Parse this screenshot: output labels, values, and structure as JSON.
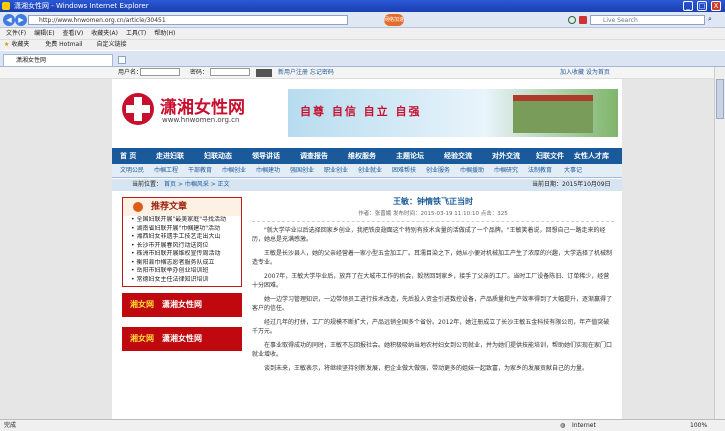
{
  "window": {
    "title": "潇湘女性网 - Windows Internet Explorer",
    "minimize": "_",
    "maximize": "□",
    "close": "X"
  },
  "address": {
    "url": "http://www.hnwomen.org.cn/article/30451",
    "search_placeholder": "Live Search",
    "popup_label": "网络加速"
  },
  "menu": [
    "文件(F)",
    "编辑(E)",
    "查看(V)",
    "收藏夹(A)",
    "工具(T)",
    "帮助(H)"
  ],
  "links": [
    "收藏夹",
    "免费 Hotmail",
    "自定义链接"
  ],
  "tab": {
    "label": "潇湘女性网"
  },
  "login": {
    "username_label": "用户名：",
    "password_label": "密码：",
    "links": "新用户注册  忘记密码",
    "right": "加入收藏  设为首页"
  },
  "site": {
    "logo_cn": "潇湘女性网",
    "logo_url": "www.hnwomen.org.cn",
    "banner_text": "自尊 自信 自立 自强"
  },
  "nav_main": [
    "首 页",
    "走进妇联",
    "妇联动态",
    "领导讲话",
    "调查报告",
    "维权服务",
    "主题论坛",
    "经验交流",
    "对外交流",
    "妇联文件",
    "女性人才库"
  ],
  "nav_sub": [
    "文明公民",
    "巾帼工程",
    "干部教育",
    "巾帼创业",
    "巾帼建功",
    "强国创业",
    "职业创业",
    "创业就业",
    "困难帮扶",
    "创业服务",
    "巾帼援助",
    "巾帼研究",
    "法制教育",
    "大事记"
  ],
  "location": {
    "prefix": "当前位置：",
    "path": "首页 > 巾帼风采 > 正文",
    "date": "当前日期：2015年10月09日"
  },
  "sidebar": {
    "title": "推荐文章",
    "items": [
      "全国妇联开展\"最美家庭\"寻找活动",
      "湖南省妇联开展\"巾帼建功\"活动",
      "湘西妇女非遗手工技艺走出大山",
      "长沙市开展春风行动送岗位",
      "株洲市妇联开展维权宣传周活动",
      "衡阳县巾帼志愿者服务队成立",
      "岳阳市妇联举办创业培训班",
      "常德妇女主任法律知识培训"
    ],
    "ad1_a": "湘女网",
    "ad1_b": "潇湘女性网",
    "ad2_a": "湘女网",
    "ad2_b": "潇湘女性网"
  },
  "article": {
    "title": "王敏：钟情铁飞正当时",
    "meta": "作者：张晋娥  发布时间：2015-03-19 11:10:10  点击：325",
    "paragraphs": [
      "\"就大学毕业以后选择回家乡创业，我把铁皮翅面这个特别有技术含量的活做成了一个品牌。\"王敏笑着说，回想自己一路走来的经历，她总是充满感激。",
      "王敏是长沙县人，她的父亲经营着一家小型五金加工厂。耳濡目染之下，她从小便对机械加工产生了浓厚的兴趣，大学选择了机械制造专业。",
      "2007年，王敏大学毕业后，放弃了在大城市工作的机会，毅然回到家乡，接手了父亲的工厂。当时工厂设备陈旧、订单稀少，经营十分困难。",
      "她一边学习管理知识，一边带领员工进行技术改造，先后投入资金引进数控设备，产品质量和生产效率得到了大幅提升，逐渐赢得了客户的信任。",
      "经过几年的打拼，工厂的规模不断扩大，产品远销全国多个省份。2012年，她注册成立了长沙王敏五金科技有限公司，年产值突破千万元。",
      "在事业取得成功的同时，王敏不忘回报社会。她积极吸纳当地农村妇女到公司就业，并为她们提供技能培训，帮助她们实现在家门口就业增收。",
      "谈到未来，王敏表示，将继续坚持创新发展，把企业做大做强，带动更多的姐妹一起致富，为家乡的发展贡献自己的力量。"
    ]
  },
  "status": {
    "left": "完成",
    "zone": "Internet",
    "zoom": "100%"
  }
}
